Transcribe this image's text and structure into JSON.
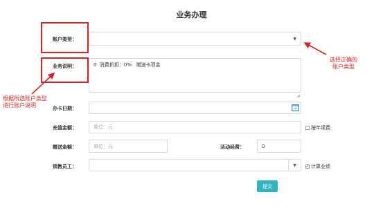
{
  "page": {
    "title": "业务办理"
  },
  "form": {
    "account_type": {
      "label": "账户类型：",
      "value": ""
    },
    "business_desc": {
      "label": "业务说明：",
      "text": "0  消费折扣：0%   赠送卡项金"
    },
    "open_date": {
      "label": "办卡日期：",
      "value": ""
    },
    "recharge_amount": {
      "label": "充值金额：",
      "placeholder": "单位：元"
    },
    "annual_renewal": {
      "label": "按年续费",
      "checked": false
    },
    "gift_amount": {
      "label": "赠送金额：",
      "placeholder": "单位：元"
    },
    "activity_fee": {
      "label": "活动经费：",
      "value": "0"
    },
    "sales_staff": {
      "label": "销售员工：",
      "value": ""
    },
    "count_performance": {
      "label": "计算业绩",
      "checked": true
    },
    "submit_label": "提交"
  },
  "annotations": {
    "right": [
      "选择正确的",
      "账户类型"
    ],
    "left": [
      "根据所选账户类型",
      "进行账户说明"
    ]
  },
  "colors": {
    "annotation": "#e02020",
    "submit": "#2fb5c2",
    "calendar": "#2f8fd0"
  }
}
